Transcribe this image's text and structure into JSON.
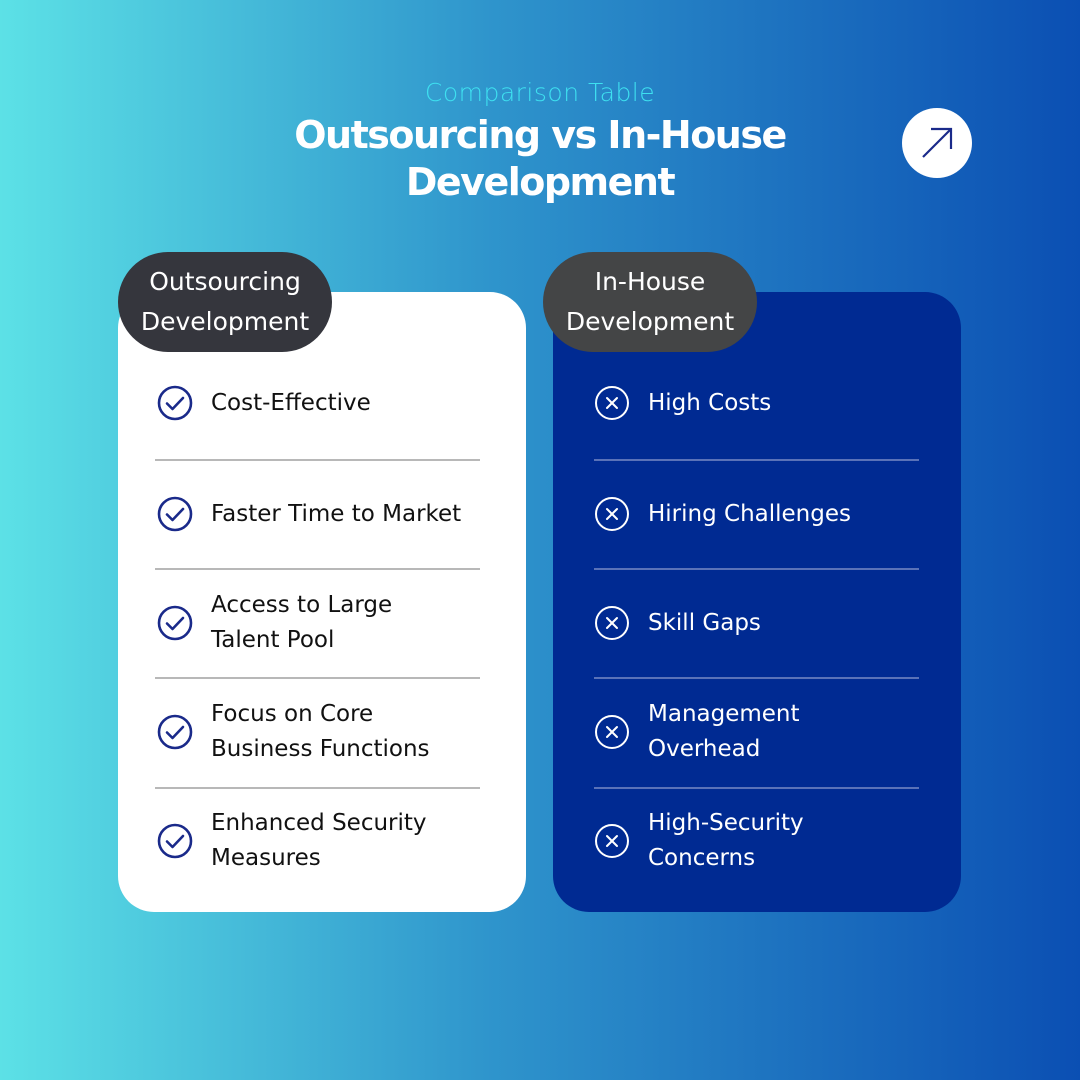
{
  "header": {
    "subtitle": "Comparison Table",
    "title_line1": "Outsourcing vs In-House",
    "title_line2": "Development",
    "arrow_icon": "arrow-up-right-icon"
  },
  "colors": {
    "background_start": "#5ce1e6",
    "background_end": "#0b4fb3",
    "left_card": "#ffffff",
    "right_card": "#002a92",
    "pill": "#35363d",
    "check_icon": "#1a2a8a",
    "accent_subtitle": "#3ee0f0"
  },
  "outsourcing": {
    "label_line1": "Outsourcing",
    "label_line2": "Development",
    "icon": "check-circle-icon",
    "items": [
      {
        "line1": "Cost-Effective",
        "line2": ""
      },
      {
        "line1": "Faster Time to Market",
        "line2": ""
      },
      {
        "line1": "Access to Large",
        "line2": "Talent Pool"
      },
      {
        "line1": "Focus on Core",
        "line2": "Business Functions"
      },
      {
        "line1": "Enhanced Security",
        "line2": "Measures"
      }
    ]
  },
  "inhouse": {
    "label_line1": "In-House",
    "label_line2": "Development",
    "icon": "x-circle-icon",
    "items": [
      {
        "line1": "High Costs",
        "line2": ""
      },
      {
        "line1": "Hiring Challenges",
        "line2": ""
      },
      {
        "line1": "Skill Gaps",
        "line2": ""
      },
      {
        "line1": "Management",
        "line2": "Overhead"
      },
      {
        "line1": "High-Security",
        "line2": "Concerns"
      }
    ]
  }
}
